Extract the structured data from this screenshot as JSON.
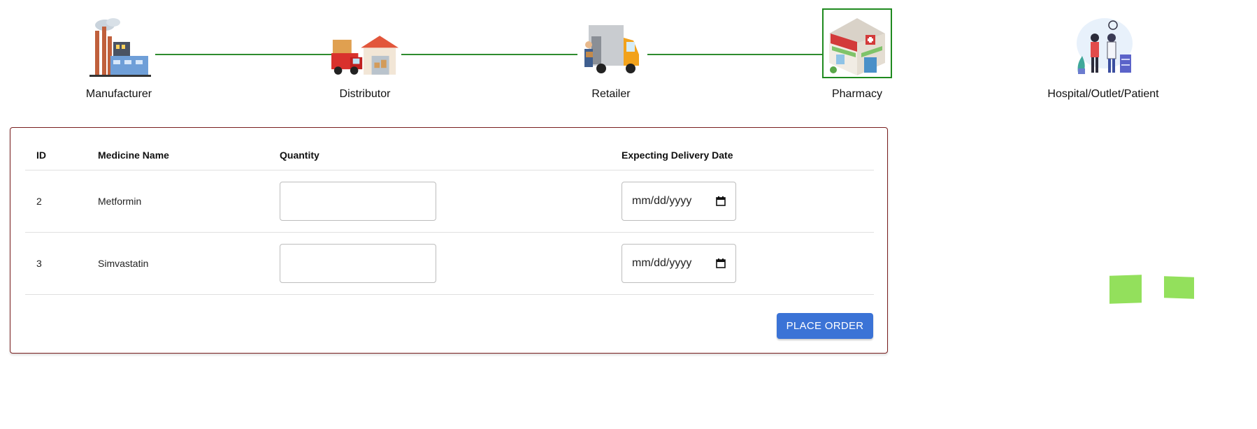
{
  "chain": {
    "steps": [
      {
        "label": "Manufacturer",
        "icon": "factory-icon"
      },
      {
        "label": "Distributor",
        "icon": "delivery-truck-warehouse-icon"
      },
      {
        "label": "Retailer",
        "icon": "van-icon"
      },
      {
        "label": "Pharmacy",
        "icon": "pharmacy-building-icon",
        "active": true
      },
      {
        "label": "Hospital/Outlet/Patient",
        "icon": "doctor-patient-icon"
      }
    ],
    "line_color": "#2e8b2e",
    "active_border_color": "#1f8a1f"
  },
  "order_table": {
    "headers": {
      "id": "ID",
      "medicine_name": "Medicine Name",
      "quantity": "Quantity",
      "delivery_date": "Expecting Delivery Date"
    },
    "rows": [
      {
        "id": "2",
        "medicine_name": "Metformin",
        "quantity": "",
        "date_placeholder": "mm/dd/yyyy"
      },
      {
        "id": "3",
        "medicine_name": "Simvastatin",
        "quantity": "",
        "date_placeholder": "mm/dd/yyyy"
      }
    ]
  },
  "actions": {
    "place_order_label": "PLACE ORDER",
    "button_color": "#3b73d6"
  },
  "card_border_color": "#7a1f1f",
  "accent_green": "#93e05c"
}
